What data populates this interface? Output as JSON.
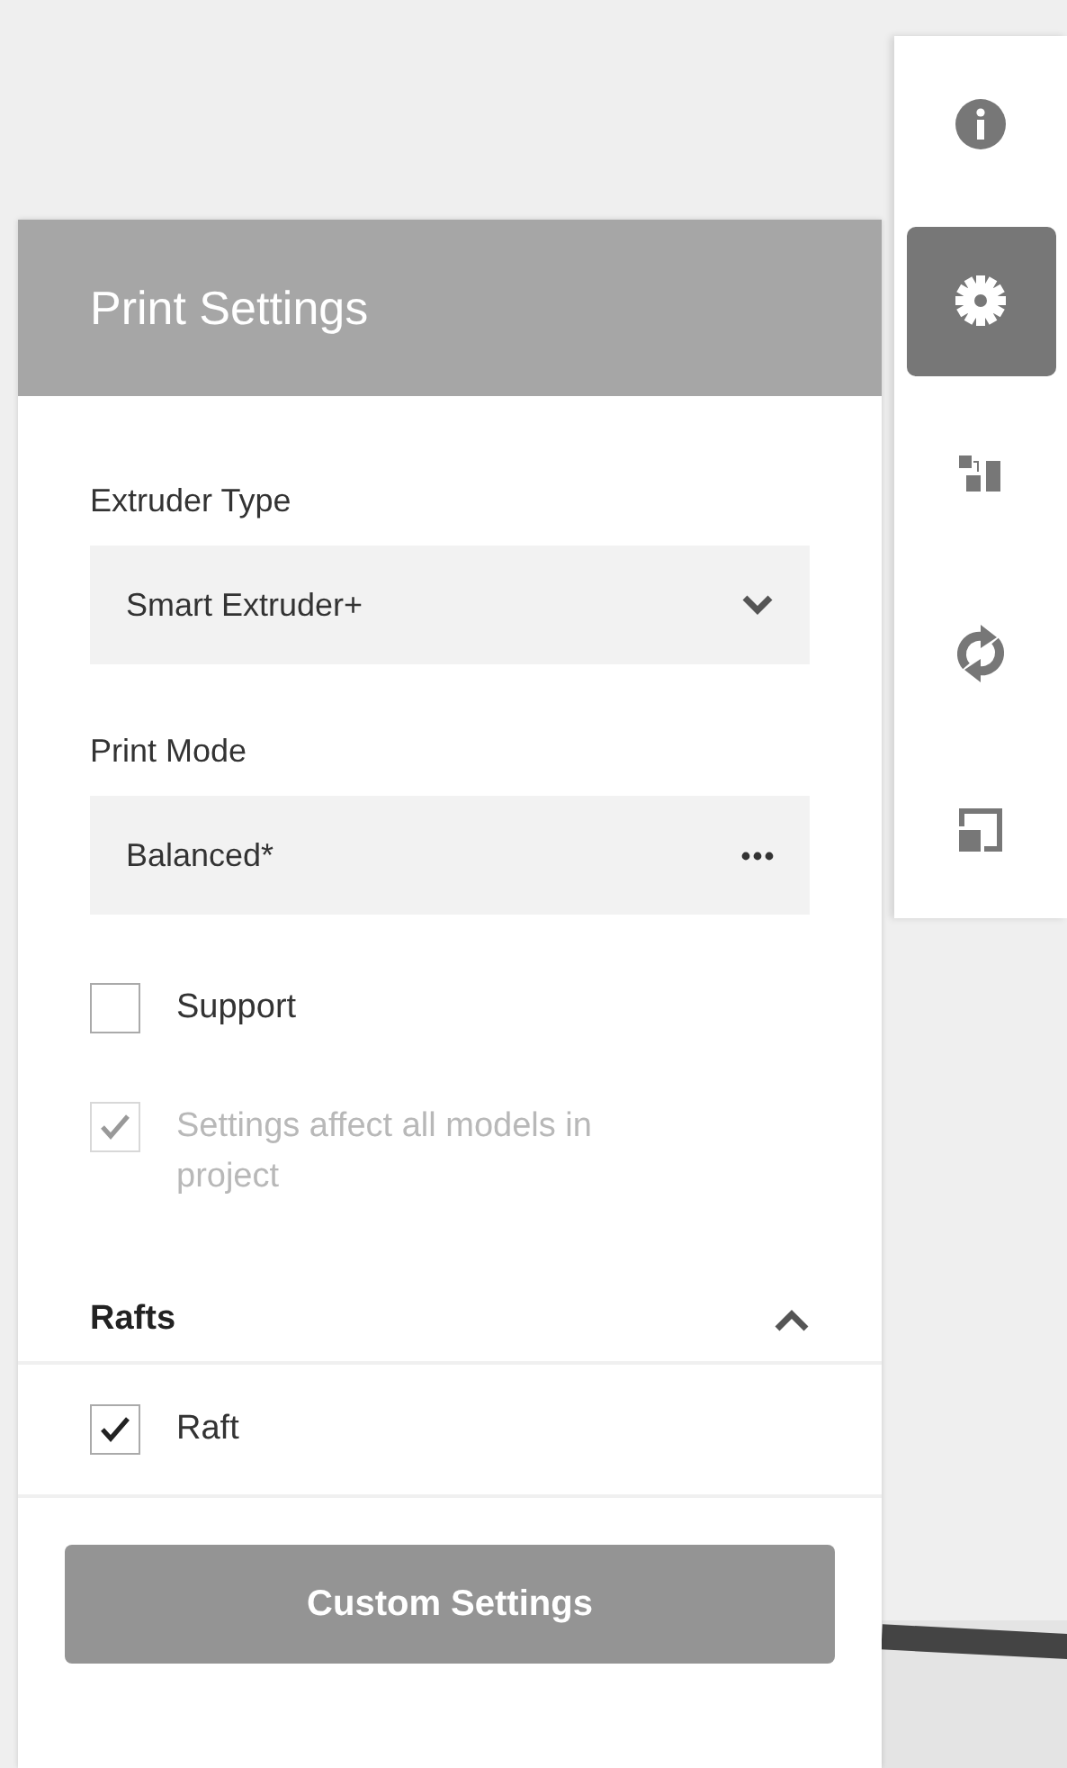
{
  "toolbar": [
    {
      "kind": "info",
      "selected": false
    },
    {
      "kind": "settings",
      "selected": true
    },
    {
      "kind": "arrange",
      "selected": false
    },
    {
      "kind": "rotate",
      "selected": false
    },
    {
      "kind": "scale",
      "selected": false
    }
  ],
  "panel": {
    "title": "Print Settings",
    "fields": [
      {
        "label": "Extruder Type",
        "value": "Smart Extruder+",
        "kind": "dropdown"
      },
      {
        "label": "Print Mode",
        "value": "Balanced*",
        "kind": "more"
      }
    ],
    "options": [
      {
        "label": "Support",
        "checked": false,
        "disabled": false
      },
      {
        "label": "Settings affect all models in project",
        "checked": true,
        "disabled": true
      }
    ],
    "section": {
      "title": "Rafts",
      "expanded": true,
      "items": [
        {
          "label": "Raft",
          "checked": true
        }
      ]
    },
    "button": "Custom Settings"
  }
}
